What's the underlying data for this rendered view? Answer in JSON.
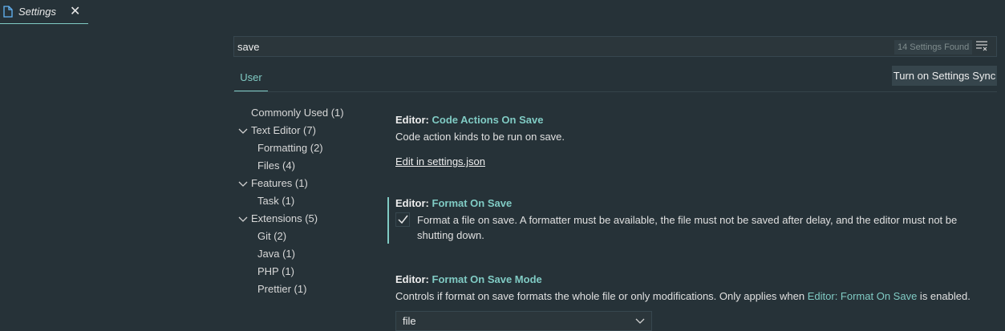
{
  "tab": {
    "label": "Settings",
    "close_glyph": "✕",
    "icon": "file-icon"
  },
  "search": {
    "value": "save",
    "results": "14 Settings Found",
    "filter_icon": "clear-filter-icon"
  },
  "scope_tab": {
    "label": "User"
  },
  "sync_button": {
    "label": "Turn on Settings Sync"
  },
  "toc": {
    "items": [
      {
        "label": "Commonly Used (1)"
      },
      {
        "label": "Text Editor (7)"
      },
      {
        "label": "Formatting (2)"
      },
      {
        "label": "Files (4)"
      },
      {
        "label": "Features (1)"
      },
      {
        "label": "Task (1)"
      },
      {
        "label": "Extensions (5)"
      },
      {
        "label": "Git (2)"
      },
      {
        "label": "Java (1)"
      },
      {
        "label": "PHP (1)"
      },
      {
        "label": "Prettier (1)"
      }
    ]
  },
  "settings": [
    {
      "category": "Editor: ",
      "name": "Code Actions On Save",
      "description": "Code action kinds to be run on save.",
      "link": "Edit in settings.json"
    },
    {
      "category": "Editor: ",
      "name": "Format On Save",
      "checked": true,
      "description": "Format a file on save. A formatter must be available, the file must not be saved after delay, and the editor must not be",
      "description2": "shutting down."
    },
    {
      "category": "Editor: ",
      "name": "Format On Save Mode",
      "description_pre": "Controls if format on save formats the whole file or only modifications. Only applies when ",
      "description_link": "Editor: Format On Save",
      "description_post": " is enabled.",
      "value": "file"
    }
  ],
  "colors": {
    "background": "#263238",
    "accent": "#80cbc4"
  }
}
